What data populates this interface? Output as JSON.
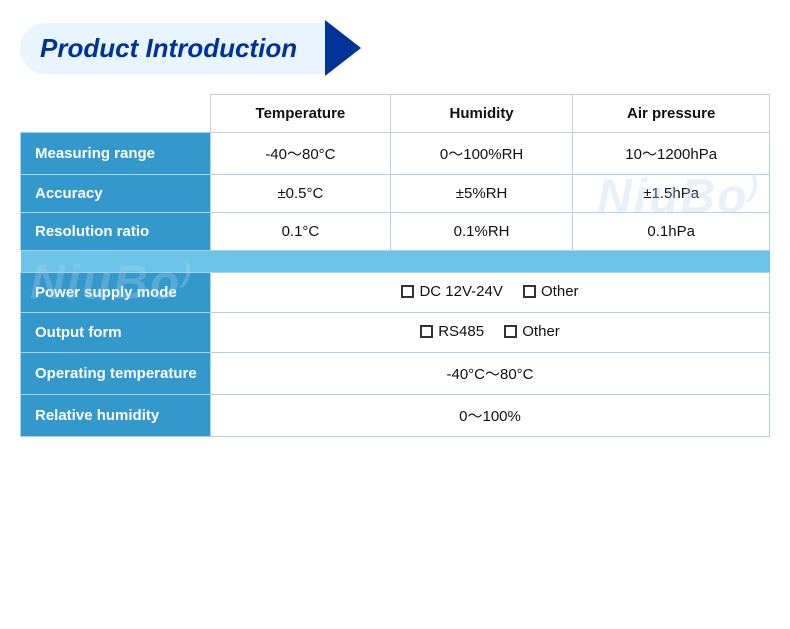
{
  "title": "Product Introduction",
  "watermark": "NiuBoL",
  "table": {
    "headers": {
      "label_col": "",
      "col1": "Temperature",
      "col2": "Humidity",
      "col3": "Air pressure"
    },
    "rows": [
      {
        "label": "Measuring range",
        "col1": "-40～80°C",
        "col2": "0～100%RH",
        "col3": "10～1200hPa"
      },
      {
        "label": "Accuracy",
        "col1": "±0.5°C",
        "col2": "±5%RH",
        "col3": "±1.5hPa"
      },
      {
        "label": "Resolution ratio",
        "col1": "0.1°C",
        "col2": "0.1%RH",
        "col3": "0.1hPa"
      }
    ],
    "bottom_rows": [
      {
        "label": "Power supply mode",
        "options": [
          {
            "checkbox": true,
            "text": "DC 12V-24V"
          },
          {
            "checkbox": true,
            "text": "Other"
          }
        ]
      },
      {
        "label": "Output form",
        "options": [
          {
            "checkbox": true,
            "text": "RS485"
          },
          {
            "checkbox": true,
            "text": "Other"
          }
        ]
      },
      {
        "label": "Operating temperature",
        "value": "-40°C～80°C"
      },
      {
        "label": "Relative humidity",
        "value": "0～100%"
      }
    ]
  },
  "colors": {
    "header_bg": "#3399cc",
    "separator": "#6bc4e8",
    "row_bg": "#ffffff",
    "label_color": "#ffffff",
    "text_color": "#111111",
    "border": "#b0d0ea",
    "title_color": "#003399"
  }
}
